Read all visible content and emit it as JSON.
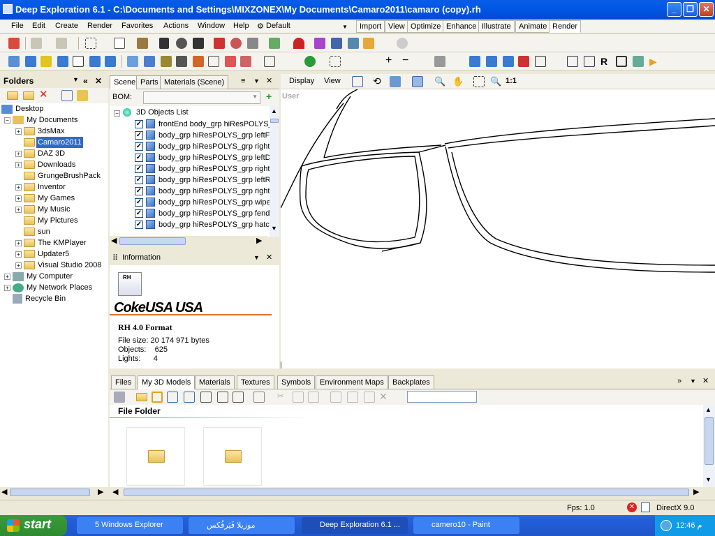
{
  "window": {
    "title": "Deep Exploration 6.1 - C:\\Documents and Settings\\MIXZONEX\\My Documents\\Camaro2011\\camaro (copy).rh"
  },
  "menu": {
    "items": [
      "File",
      "Edit",
      "Create",
      "Render",
      "Favorites",
      "Actions",
      "Window",
      "Help"
    ],
    "workspace": "Default",
    "modes": [
      "Import",
      "View",
      "Optimize",
      "Enhance",
      "Illustrate",
      "Animate",
      "Render"
    ],
    "active_mode": "Render"
  },
  "folders": {
    "title": "Folders",
    "items": [
      {
        "label": "Desktop"
      },
      {
        "label": "My Documents"
      },
      {
        "label": "3dsMax"
      },
      {
        "label": "Camaro2011"
      },
      {
        "label": "DAZ 3D"
      },
      {
        "label": "Downloads"
      },
      {
        "label": "GrungeBrushPack"
      },
      {
        "label": "Inventor"
      },
      {
        "label": "My Games"
      },
      {
        "label": "My Music"
      },
      {
        "label": "My Pictures"
      },
      {
        "label": "sun"
      },
      {
        "label": "The KMPlayer"
      },
      {
        "label": "Updater5"
      },
      {
        "label": "Visual Studio 2008"
      },
      {
        "label": "My Computer"
      },
      {
        "label": "My Network Places"
      },
      {
        "label": "Recycle Bin"
      }
    ]
  },
  "scene": {
    "tabs": [
      "Scene",
      "Parts",
      "Materials (Scene)"
    ],
    "bom_label": "BOM:",
    "list_title": "3D Objects List",
    "objects": [
      "frontEnd body_grp hiResPOLYS_",
      "body_grp hiResPOLYS_grp leftFr",
      "body_grp hiResPOLYS_grp rightI",
      "body_grp hiResPOLYS_grp leftD",
      "body_grp hiResPOLYS_grp rightI",
      "body_grp hiResPOLYS_grp leftR",
      "body_grp hiResPOLYS_grp rightI",
      "body_grp hiResPOLYS_grp wiper",
      "body_grp hiResPOLYS_grp fende",
      "body_grp hiResPOLYS_grp hatch"
    ]
  },
  "information": {
    "title": "Information",
    "file_badge": "RH",
    "brand": "CokeUSA  USA",
    "format": "RH 4.0 Format",
    "rows": [
      {
        "label": "File size:",
        "value": "20 174 971 bytes"
      },
      {
        "label": "Objects:",
        "value": "625"
      },
      {
        "label": "Lights:",
        "value": "4"
      }
    ]
  },
  "viewport": {
    "toolbar": {
      "display": "Display",
      "view": "View",
      "zoom_ratio": "1:1"
    },
    "label": "User"
  },
  "bottom": {
    "tabs": [
      "Files",
      "My 3D Models",
      "Materials",
      "Textures",
      "Symbols",
      "Environment Maps",
      "Backplates"
    ],
    "active_tab": "My 3D Models",
    "section_title": "File Folder"
  },
  "status": {
    "fps": "Fps:  1.0",
    "renderer": "DirectX 9.0"
  },
  "taskbar": {
    "start": "start",
    "tasks": [
      "5 Windows Explorer",
      "موزيلا فَيَرفُكس",
      "Deep Exploration 6.1 ...",
      "camero10 - Paint"
    ],
    "clock": "12:46 م"
  },
  "colors": {
    "title_blue": "#0058e6",
    "selection": "#316ac5",
    "accent_orange": "#e8702a"
  }
}
